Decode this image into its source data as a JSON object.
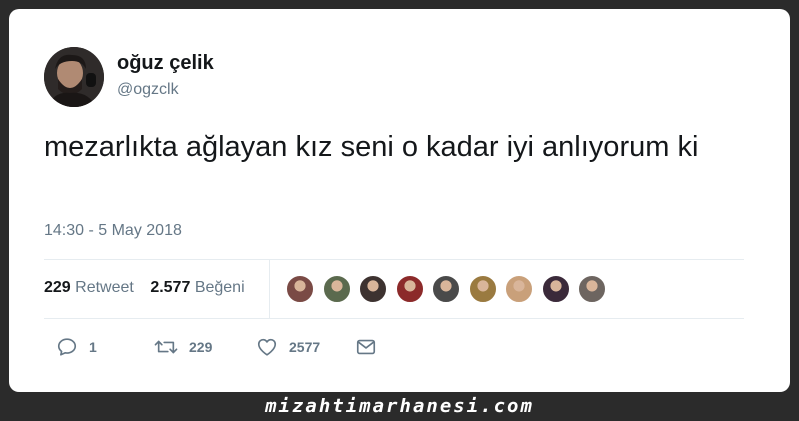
{
  "author": {
    "display_name": "oğuz çelik",
    "handle": "@ogzclk"
  },
  "tweet": {
    "text": "mezarlıkta ağlayan kız seni o kadar iyi anlıyorum ki",
    "timestamp": "14:30 - 5 May 2018"
  },
  "stats": {
    "retweets_count": "229",
    "retweets_label": "Retweet",
    "likes_count": "2.577",
    "likes_label": "Beğeni"
  },
  "likers": {
    "count": 9,
    "colors": [
      "#7a4a45",
      "#5b6a4e",
      "#3d3230",
      "#8c2a2a",
      "#4a4a4a",
      "#9a7a40",
      "#c9a07a",
      "#3b2a3a",
      "#6d6560"
    ]
  },
  "actions": {
    "reply_count": "1",
    "retweet_count": "229",
    "like_count": "2577"
  },
  "watermark": "mizahtimarhanesi.com",
  "colors": {
    "background": "#2b2b2b",
    "card": "#ffffff",
    "primary_text": "#14171a",
    "secondary_text": "#657786",
    "divider": "#e6ecf0"
  }
}
